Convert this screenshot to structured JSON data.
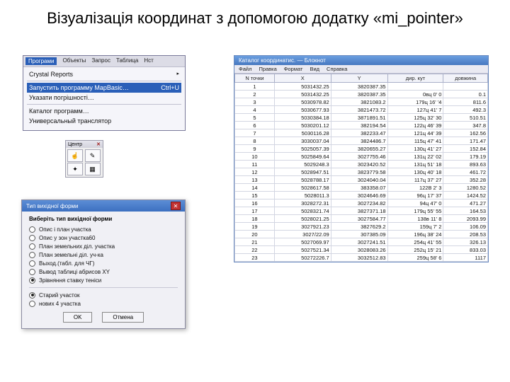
{
  "title": "Візуалізація координат з допомогою додатку «mi_pointer»",
  "menu": {
    "bar": [
      "Програми",
      "Объекты",
      "Запрос",
      "Таблица",
      "Нст"
    ],
    "items": [
      {
        "label": "Crystal Reports",
        "arrow": "▸",
        "hl": false
      },
      {
        "label": "Запустить программу MapBasic…",
        "shortcut": "Ctrl+U",
        "hl": true
      },
      {
        "label": "Указати погрішності…",
        "hl": false
      },
      {
        "label": "Каталог программ…",
        "hl": false
      },
      {
        "label": "Универсальный транслятор",
        "hl": false
      }
    ]
  },
  "toolbox": {
    "title": "Центр",
    "close": "✕",
    "tools": [
      "☝",
      "✎",
      "✦",
      "▦"
    ]
  },
  "dialog": {
    "title": "Тип вихідної форми",
    "close": "✕",
    "label": "Виберіть тип вихідної форми",
    "opts": [
      {
        "t": "Опис і план участка",
        "on": false
      },
      {
        "t": "Опис у зон участка60",
        "on": false
      },
      {
        "t": "План земельних діл. участка",
        "on": false
      },
      {
        "t": "План земельні діл. уч-ка",
        "on": false
      },
      {
        "t": "Выход.(табл. для ЧГ)",
        "on": false
      },
      {
        "t": "Вывод таблиці абрисов XY",
        "on": false
      },
      {
        "t": "Зрівняння ставку теніси",
        "on": true
      }
    ],
    "opts2": [
      {
        "t": "Старий участок",
        "on": true
      },
      {
        "t": "нових 4 участка",
        "on": false
      }
    ],
    "ok": "OK",
    "cancel": "Отмена"
  },
  "coord": {
    "title": "Каталог координатис. — Блокнот",
    "menu": [
      "Файл",
      "Правка",
      "Формат",
      "Вид",
      "Справка"
    ],
    "headers": [
      "N точки",
      "X",
      "Y",
      "дир. кут",
      "довжина"
    ],
    "rows": [
      [
        "1",
        "5031432.25",
        "3820387.35",
        "",
        ""
      ],
      [
        "2",
        "5031432.25",
        "3820387.35",
        "0вц 0' 0",
        "0.1"
      ],
      [
        "3",
        "5030978.82",
        "3821083.2",
        "179ц 16' '4",
        "811.6"
      ],
      [
        "4",
        "5030677.93",
        "3821473.72",
        "127ц 41' 7",
        "492.3"
      ],
      [
        "5",
        "5030384.18",
        "3871891.51",
        "125ц 32' 30",
        "510.51"
      ],
      [
        "6",
        "5030201.12",
        "382194.54",
        "122ц 46' 39",
        "347.8"
      ],
      [
        "7",
        "5030116.28",
        "382233.47",
        "121ц 44' 39",
        "162.56"
      ],
      [
        "8",
        "3030037.04",
        "3824486.7",
        "115ц 47' 41",
        "171.47"
      ],
      [
        "9",
        "5025057.39",
        "3820655.27",
        "130ц 41' 27",
        "152.84"
      ],
      [
        "10",
        "5025849.64",
        "3027755.46",
        "131ц 22' 02",
        "179.19"
      ],
      [
        "11",
        "5029248.3",
        "3023420.52",
        "131ц 51' 18",
        "893.63"
      ],
      [
        "12",
        "5028947.51",
        "3823779.58",
        "130ц 40' 18",
        "461.72"
      ],
      [
        "13",
        "5028788.17",
        "3024040.04",
        "117ц 37' 27",
        "352.28"
      ],
      [
        "14",
        "5028617.58",
        "383358.07",
        "122В 2' 3",
        "1280.52"
      ],
      [
        "15",
        "5028011.3",
        "3024646.69",
        "96ц 17' 37",
        "1424.52"
      ],
      [
        "16",
        "3028272.31",
        "3027234.82",
        "94ц 47' 0",
        "471.27"
      ],
      [
        "17",
        "5028321.74",
        "3827371.18",
        "179ц 55' 55",
        "164.53"
      ],
      [
        "18",
        "5028021.25",
        "3027584.77",
        "138в 11' 8",
        "2093.99"
      ],
      [
        "19",
        "3027921.23",
        "3827629.2",
        "159ц 7' 2",
        "106.09"
      ],
      [
        "20",
        "3027/22.09",
        "307385.09",
        "196ц 38' 24",
        "208.53"
      ],
      [
        "21",
        "5027069.97",
        "3027241.51",
        "254ц 41' 55",
        "326.13"
      ],
      [
        "22",
        "5027521.34",
        "3028083.26",
        "252ц 15' 21",
        "833.03"
      ],
      [
        "23",
        "50272226.7",
        "3032512.83",
        "259ц 58' 6",
        "1117"
      ]
    ]
  }
}
